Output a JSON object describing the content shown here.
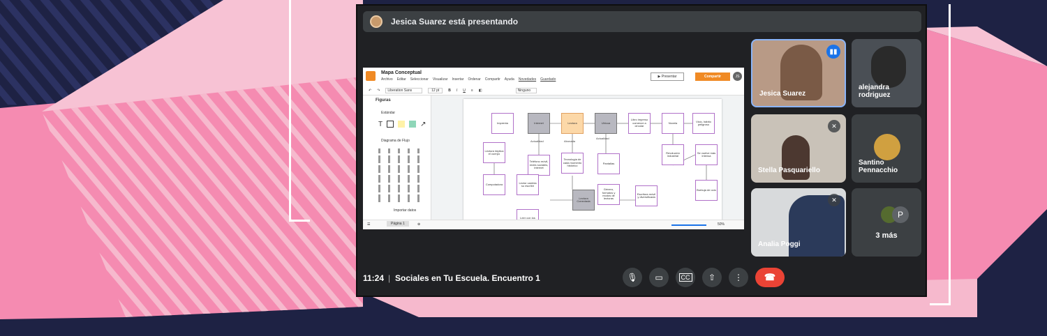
{
  "banner": {
    "text": "Jesica Suarez está presentando"
  },
  "doc": {
    "title": "Mapa Conceptual",
    "menu": [
      "Archivo",
      "Editar",
      "Seleccionar",
      "Visualizar",
      "Insertar",
      "Ordenar",
      "Compartir",
      "Ayuda",
      "Novedades",
      "Guardado"
    ],
    "present": "Presentar",
    "share": "Compartir",
    "user_initials": "JS",
    "font": "Liberation Sans",
    "font_size": "12 pt",
    "line_style": "Ninguno",
    "panel_title": "Figuras",
    "section_standard": "Estándar",
    "section_flow": "Diagrama de Flujo",
    "import": "Importar datos",
    "page_label": "Página 1",
    "zoom": "50%",
    "nodes": [
      {
        "id": "n1",
        "text": "Imprenta",
        "style": "plain"
      },
      {
        "id": "n2",
        "text": "Internet",
        "style": "gray"
      },
      {
        "id": "n3",
        "text": "Lectura",
        "style": "orange"
      },
      {
        "id": "n4",
        "text": "Ubicua",
        "style": "gray"
      },
      {
        "id": "n5",
        "text": "Libro impreso comenzó a circular",
        "style": "plain"
      },
      {
        "id": "n6",
        "text": "Novela",
        "style": "plain"
      },
      {
        "id": "n7",
        "text": "Vicio, hábito peligroso",
        "style": "plain"
      },
      {
        "id": "n8",
        "text": "Lectura implica el cuerpo",
        "style": "plain"
      },
      {
        "id": "n9",
        "text": "Teléfono móvil, redes sociales, internet",
        "style": "plain"
      },
      {
        "id": "n10",
        "text": "Tecnología de cada momento histórico",
        "style": "plain"
      },
      {
        "id": "n11",
        "text": "Pantallas",
        "style": "plain"
      },
      {
        "id": "n12",
        "text": "Revolución industrial",
        "style": "plain"
      },
      {
        "id": "n13",
        "text": "Se vuelve más intensa",
        "style": "plain"
      },
      {
        "id": "n14",
        "text": "Computadora",
        "style": "plain"
      },
      {
        "id": "n15",
        "text": "Lector cambia su escribir",
        "style": "plain"
      },
      {
        "id": "n16",
        "text": "Lectura Conectada",
        "style": "gray"
      },
      {
        "id": "n17",
        "text": "Género, formatos y modos de lecturas",
        "style": "plain"
      },
      {
        "id": "n18",
        "text": "Escritura móvil y diversificada",
        "style": "plain"
      },
      {
        "id": "n19",
        "text": "Burbuja de ocio",
        "style": "plain"
      },
      {
        "id": "n20",
        "text": "Leer con los ojos y..",
        "style": "plain"
      }
    ],
    "edge_labels": [
      "Actualidad",
      "Abonada",
      "Actualidad"
    ]
  },
  "participants": [
    {
      "name": "Jesica Suarez",
      "speaking": true,
      "muted": false
    },
    {
      "name": "alejandra rodriguez",
      "speaking": false,
      "muted": false
    },
    {
      "name": "Stella Pasquariello",
      "speaking": false,
      "muted": true
    },
    {
      "name": "Santino Pennacchio",
      "speaking": false,
      "muted": false
    },
    {
      "name": "Analia Poggi",
      "speaking": false,
      "muted": true
    }
  ],
  "more": {
    "label": "3 más",
    "avatar_letter": "P"
  },
  "bottom": {
    "time": "11:24",
    "separator": "|",
    "meeting_name": "Sociales en Tu Escuela. Encuentro 1"
  },
  "colors": {
    "end_call": "#ea4335",
    "accent": "#1a73e8",
    "bg_navy": "#1e2244",
    "bg_pink": "#f58bb1"
  }
}
